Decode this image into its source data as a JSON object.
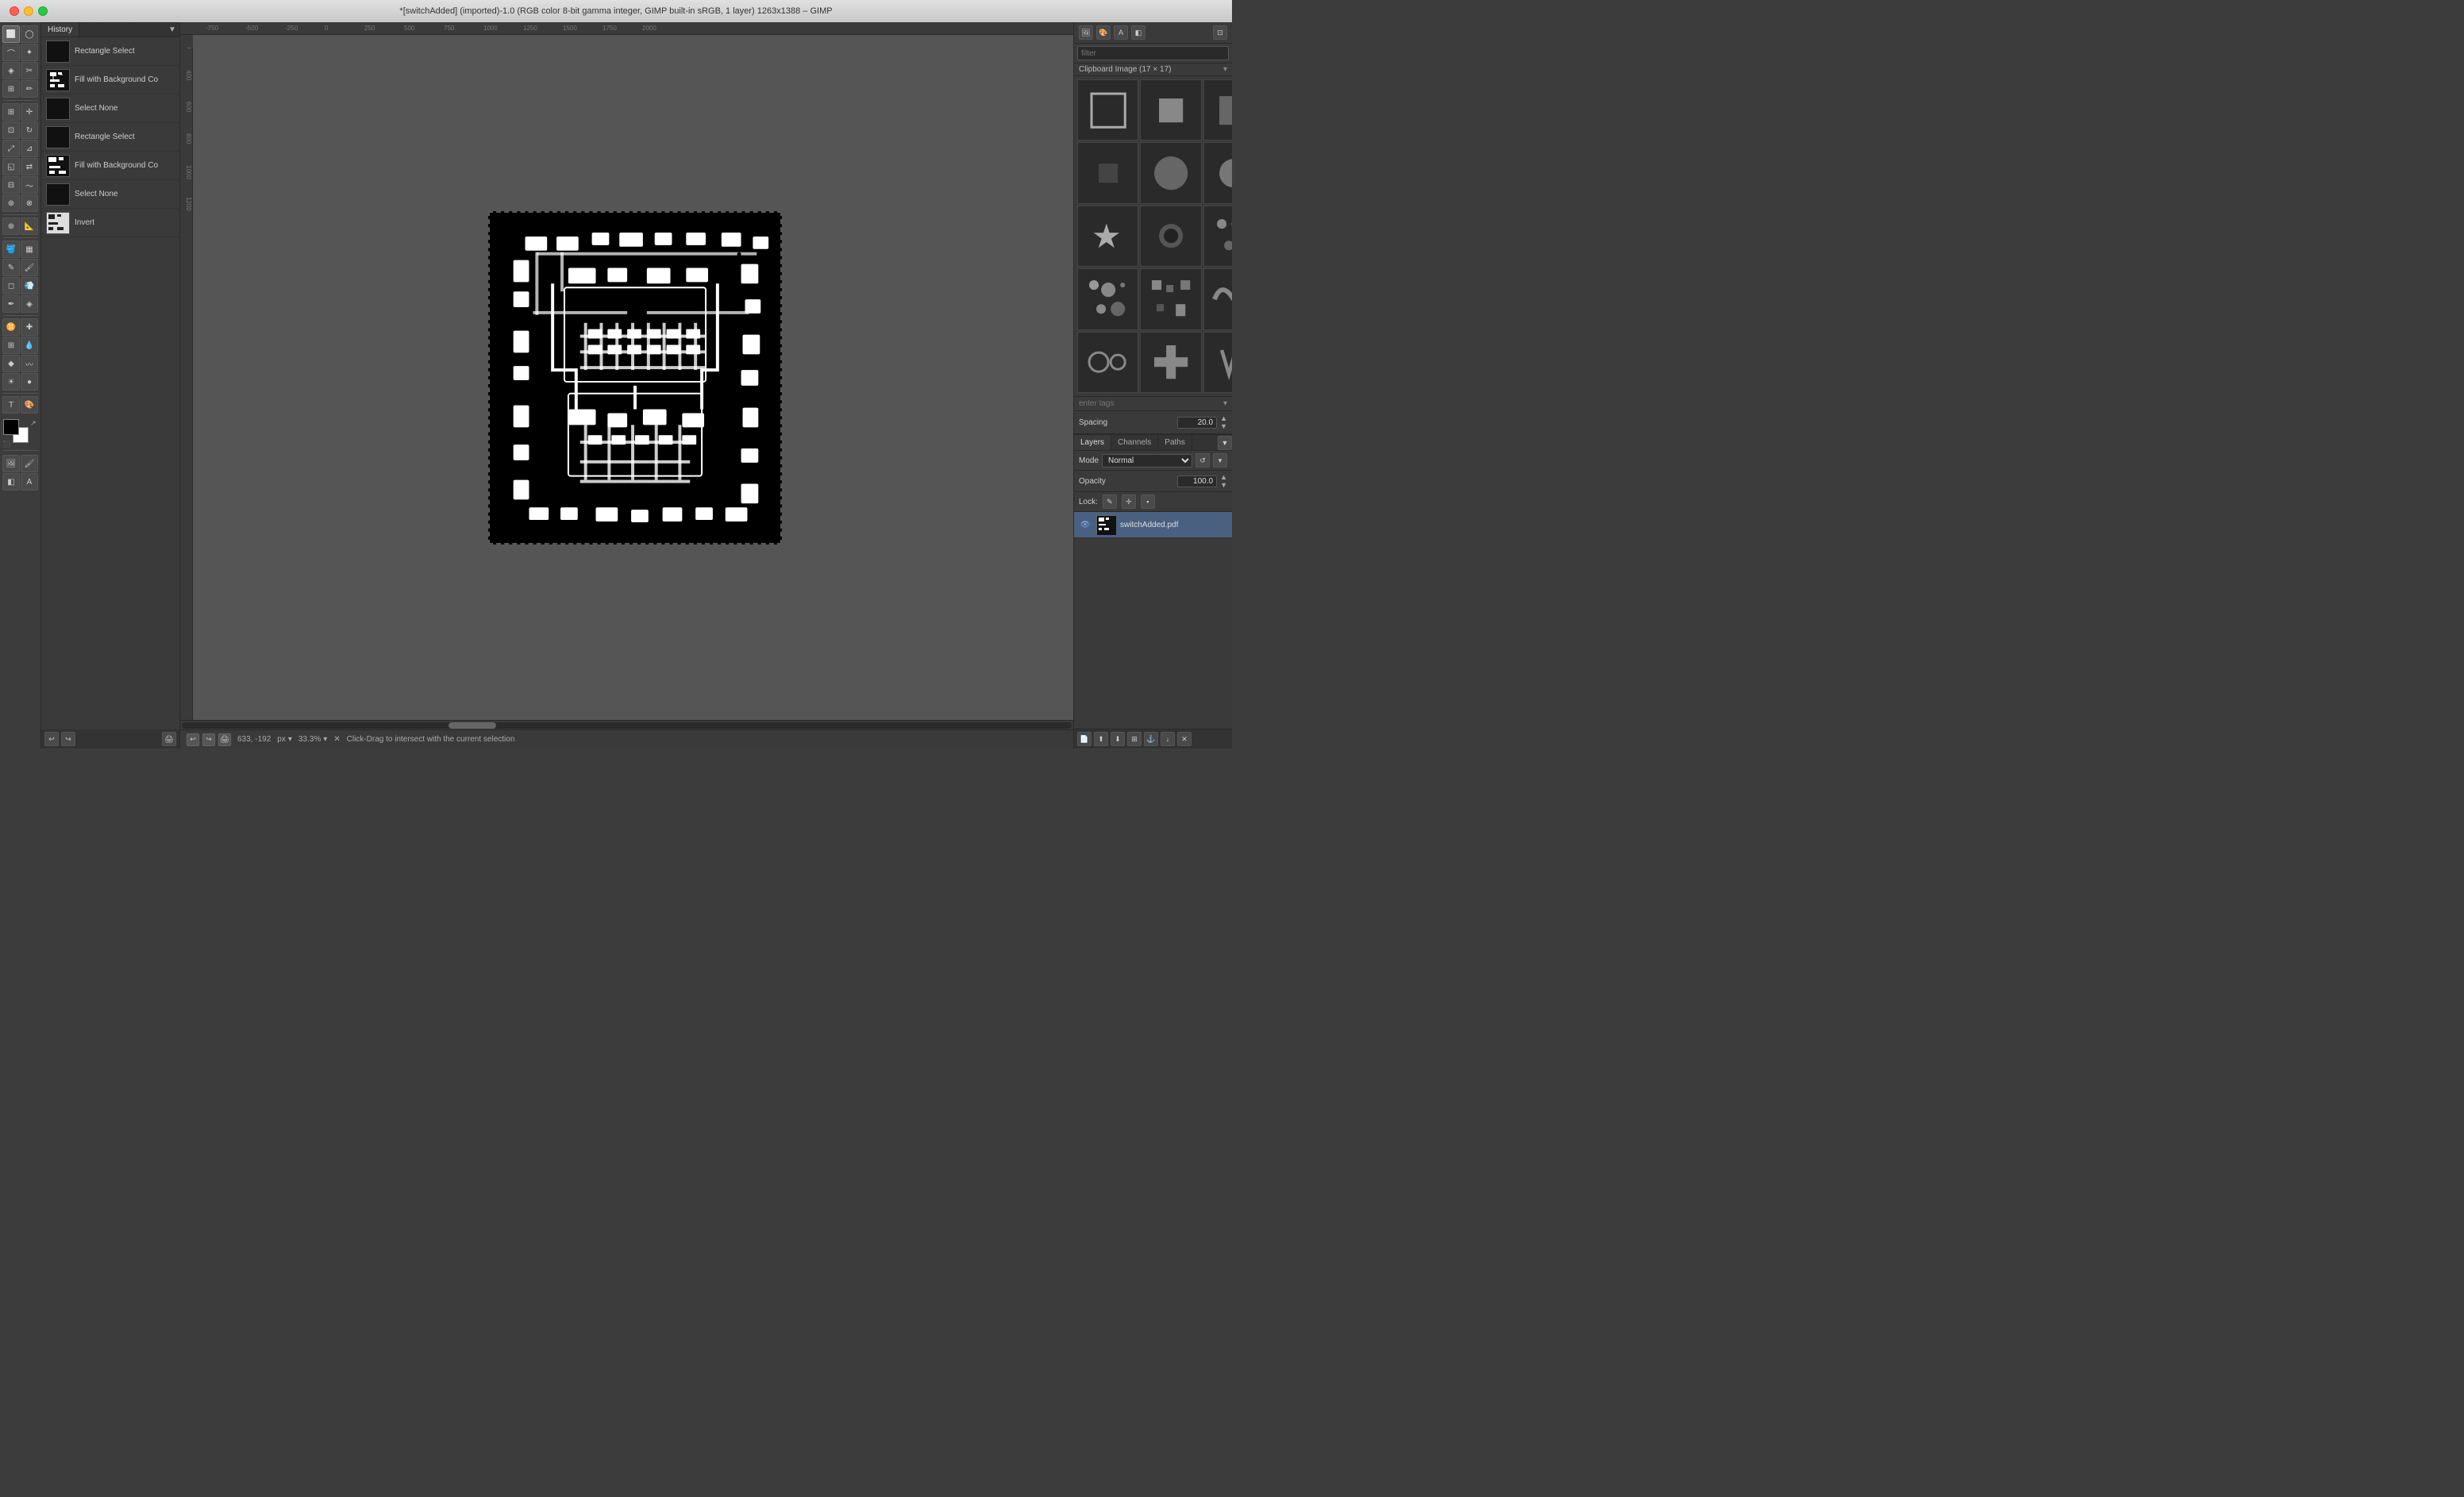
{
  "titlebar": {
    "title": "*[switchAdded] (imported)-1.0 (RGB color 8-bit gamma integer, GIMP built-in sRGB, 1 layer) 1263x1388 – GIMP"
  },
  "toolbar": {
    "tools": [
      {
        "name": "rectangle-select",
        "icon": "⬜"
      },
      {
        "name": "ellipse-select",
        "icon": "⭕"
      },
      {
        "name": "free-select",
        "icon": "🔗"
      },
      {
        "name": "fuzzy-select",
        "icon": "✦"
      },
      {
        "name": "by-color-select",
        "icon": "◈"
      },
      {
        "name": "scissors",
        "icon": "✂"
      },
      {
        "name": "foreground-select",
        "icon": "◉"
      },
      {
        "name": "paths",
        "icon": "✏"
      },
      {
        "name": "align",
        "icon": "⊞"
      },
      {
        "name": "move",
        "icon": "✛"
      },
      {
        "name": "crop",
        "icon": "⊡"
      },
      {
        "name": "rotate",
        "icon": "↻"
      },
      {
        "name": "scale",
        "icon": "⤢"
      },
      {
        "name": "shear",
        "icon": "⊿"
      },
      {
        "name": "perspective",
        "icon": "◱"
      },
      {
        "name": "flip",
        "icon": "⇄"
      },
      {
        "name": "cage",
        "icon": "⊟"
      },
      {
        "name": "warp",
        "icon": "〜"
      },
      {
        "name": "unified-transform",
        "icon": "⊕"
      },
      {
        "name": "handle-transform",
        "icon": "⊗"
      },
      {
        "name": "zoom",
        "icon": "🔍"
      },
      {
        "name": "measure",
        "icon": "📏"
      },
      {
        "name": "paint-bucket",
        "icon": "🪣"
      },
      {
        "name": "blend",
        "icon": "🌈"
      },
      {
        "name": "pencil",
        "icon": "✎"
      },
      {
        "name": "paintbrush",
        "icon": "🖌"
      },
      {
        "name": "eraser",
        "icon": "◻"
      },
      {
        "name": "airbrush",
        "icon": "💨"
      },
      {
        "name": "ink",
        "icon": "✒"
      },
      {
        "name": "mypaint",
        "icon": "◈"
      },
      {
        "name": "clone",
        "icon": "♊"
      },
      {
        "name": "heal",
        "icon": "✚"
      },
      {
        "name": "perspective-clone",
        "icon": "⊞"
      },
      {
        "name": "blur",
        "icon": "💧"
      },
      {
        "name": "sharpen",
        "icon": "◆"
      },
      {
        "name": "smudge",
        "icon": "〰"
      },
      {
        "name": "dodge",
        "icon": "☀"
      },
      {
        "name": "burn",
        "icon": "🔥"
      },
      {
        "name": "text",
        "icon": "T"
      },
      {
        "name": "colorize",
        "icon": "🎨"
      }
    ],
    "foreground_color": "#000000",
    "background_color": "#ffffff"
  },
  "history": {
    "tabs": [
      {
        "label": "History",
        "active": true
      },
      {
        "label": ""
      },
      {
        "label": ""
      },
      {
        "label": ""
      }
    ],
    "items": [
      {
        "label": "Rectangle Select",
        "thumb_type": "dark"
      },
      {
        "label": "Fill with Background Co",
        "thumb_type": "circuit"
      },
      {
        "label": "Select None",
        "thumb_type": "dark"
      },
      {
        "label": "Rectangle Select",
        "thumb_type": "dark"
      },
      {
        "label": "Fill with Background Co",
        "thumb_type": "circuit"
      },
      {
        "label": "Select None",
        "thumb_type": "dark"
      },
      {
        "label": "Invert",
        "thumb_type": "circuit"
      }
    ]
  },
  "canvas": {
    "title": "*[switchAdded]",
    "zoom": "33.3%",
    "unit": "px",
    "coords": "633, -192",
    "status_msg": "Click-Drag to intersect with the current selection",
    "ruler_marks_h": [
      "-750",
      "-500",
      "-250",
      "0",
      "250",
      "500",
      "750",
      "1000",
      "1250",
      "1500",
      "1750",
      "2000"
    ],
    "ruler_marks_v": [
      "200",
      "400",
      "600",
      "800",
      "1000",
      "1200"
    ]
  },
  "brush_panel": {
    "title": "Clipboard Image (17 × 17)",
    "filter_placeholder": "filter",
    "tags_placeholder": "enter tags",
    "spacing_label": "Spacing",
    "spacing_value": "20.0"
  },
  "layers_panel": {
    "tabs": [
      {
        "label": "Layers",
        "active": true
      },
      {
        "label": "Channels"
      },
      {
        "label": "Paths"
      }
    ],
    "mode_label": "Mode",
    "mode_value": "Normal",
    "opacity_label": "Opacity",
    "opacity_value": "100.0",
    "lock_label": "Lock:",
    "layers": [
      {
        "name": "switchAdded.pdf",
        "visible": true,
        "thumb_type": "circuit"
      }
    ],
    "toolbar_btns": [
      "📄",
      "⬆",
      "⬇",
      "🗑",
      "↑",
      "↓",
      "⚙",
      "✕"
    ]
  }
}
